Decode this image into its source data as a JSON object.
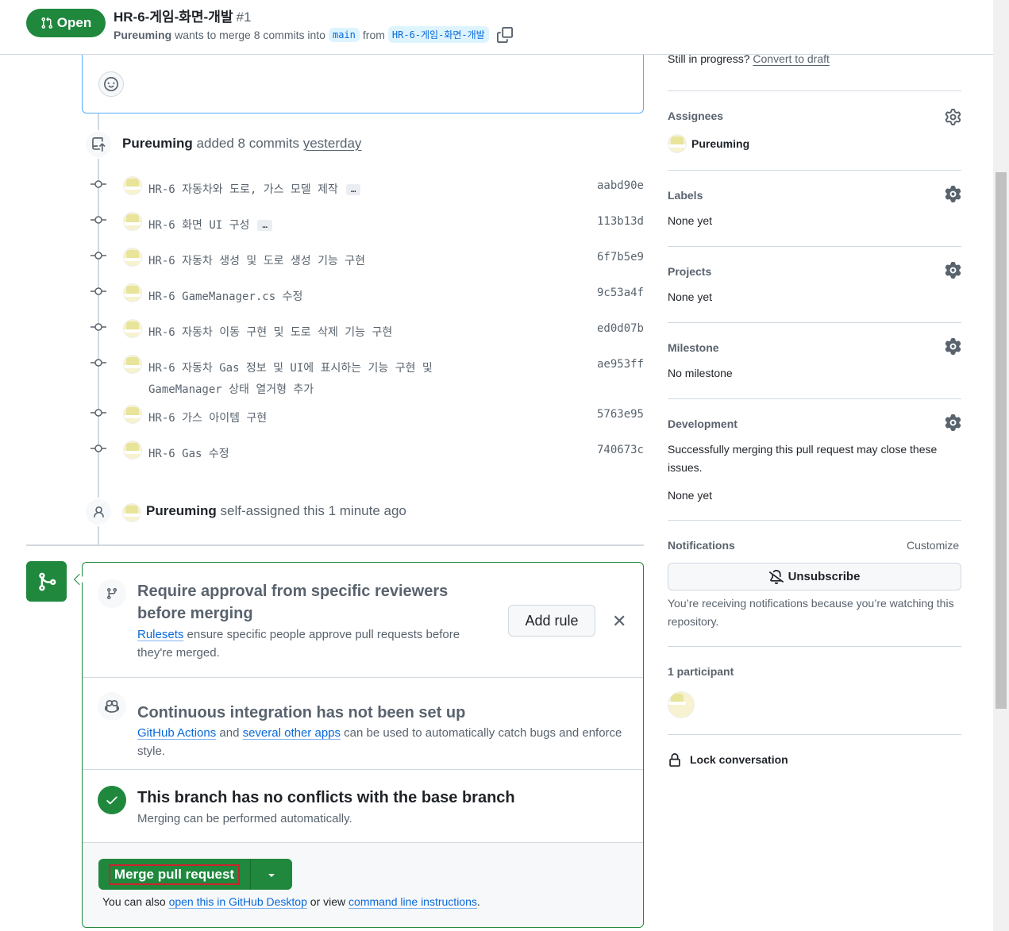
{
  "header": {
    "status": "Open",
    "title": "HR-6-게임-화면-개발",
    "number": "#1",
    "author": "Pureuming",
    "merge_text": "wants to merge 8 commits into",
    "base_branch": "main",
    "from_text": "from",
    "head_branch": "HR-6-게임-화면-개발"
  },
  "timeline": {
    "added_event": {
      "actor": "Pureuming",
      "action": "added 8 commits",
      "time": "yesterday"
    },
    "commits": [
      {
        "message": "HR-6 자동차와 도로, 가스 모델 제작",
        "sha": "aabd90e",
        "has_more": true
      },
      {
        "message": "HR-6 화면 UI 구성",
        "sha": "113b13d",
        "has_more": true
      },
      {
        "message": "HR-6 자동차 생성 및 도로 생성 기능 구현",
        "sha": "6f7b5e9",
        "has_more": false
      },
      {
        "message": "HR-6 GameManager.cs 수정",
        "sha": "9c53a4f",
        "has_more": false
      },
      {
        "message": "HR-6 자동차 이동 구현 및 도로 삭제 기능 구현",
        "sha": "ed0d07b",
        "has_more": false
      },
      {
        "message": "HR-6 자동차 Gas 정보 및 UI에 표시하는 기능 구현 및 GameManager 상태 열거형 추가",
        "sha": "ae953ff",
        "has_more": false
      },
      {
        "message": "HR-6 가스 아이템 구현",
        "sha": "5763e95",
        "has_more": false
      },
      {
        "message": "HR-6 Gas 수정",
        "sha": "740673c",
        "has_more": false
      }
    ],
    "ellipsis_label": "…",
    "assign_event": {
      "actor": "Pureuming",
      "action": "self-assigned this 1 minute ago"
    }
  },
  "merge_box": {
    "approval": {
      "title": "Require approval from specific reviewers before merging",
      "link": "Rulesets",
      "desc": "ensure specific people approve pull requests before they're merged.",
      "button": "Add rule",
      "close": "✕"
    },
    "ci": {
      "title": "Continuous integration has not been set up",
      "link1": "GitHub Actions",
      "and": "and",
      "link2": "several other apps",
      "desc": "can be used to automatically catch bugs and enforce style."
    },
    "conflicts": {
      "title": "This branch has no conflicts with the base branch",
      "desc": "Merging can be performed automatically."
    },
    "merge_button": "Merge pull request",
    "note_prefix": "You can also",
    "note_link1": "open this in GitHub Desktop",
    "note_mid": "or view",
    "note_link2": "command line instructions",
    "note_suffix": "."
  },
  "sidebar": {
    "draft_prefix": "Still in progress?",
    "draft_link": "Convert to draft",
    "assignees": {
      "label": "Assignees",
      "value": "Pureuming"
    },
    "labels": {
      "label": "Labels",
      "value": "None yet"
    },
    "projects": {
      "label": "Projects",
      "value": "None yet"
    },
    "milestone": {
      "label": "Milestone",
      "value": "No milestone"
    },
    "development": {
      "label": "Development",
      "desc": "Successfully merging this pull request may close these issues.",
      "value": "None yet"
    },
    "notifications": {
      "label": "Notifications",
      "customize": "Customize",
      "button": "Unsubscribe",
      "desc": "You’re receiving notifications because you’re watching this repository."
    },
    "participants": {
      "label": "1 participant"
    },
    "lock": "Lock conversation"
  },
  "colors": {
    "accent": "#1f883d",
    "link": "#0969da",
    "muted": "#59636e"
  }
}
